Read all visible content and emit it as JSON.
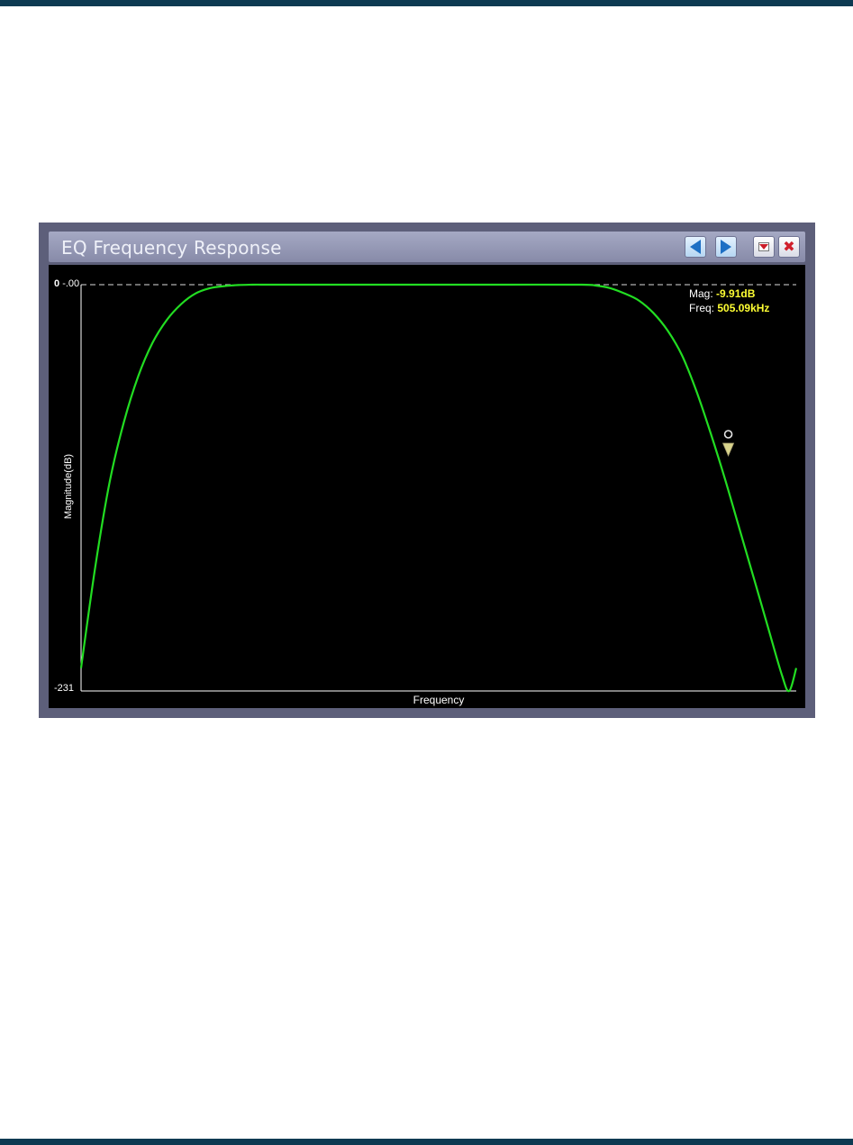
{
  "window": {
    "title": "EQ Frequency Response",
    "buttons": {
      "prev": "previous-icon",
      "next": "next-icon",
      "menu": "dropdown-icon",
      "close": "close-icon"
    }
  },
  "readout": {
    "mag_label": "Mag:",
    "mag_value": "-9.91dB",
    "freq_label": "Freq:",
    "freq_value": "505.09kHz"
  },
  "colors": {
    "curve": "#22dd22",
    "plot_bg": "#000000",
    "window_bg": "#5d5f7a",
    "readout_value": "#ffff33",
    "page_bar": "#0d3a52"
  },
  "chart_data": {
    "type": "line",
    "xlabel": "Frequency",
    "ylabel": "Magnitude(dB)",
    "ylim": [
      -231,
      0
    ],
    "ytick_labels": {
      "top": "0",
      "top_overlap": "-.00",
      "bottom": "-231"
    },
    "x_relative": [
      0.0,
      0.02,
      0.04,
      0.06,
      0.08,
      0.1,
      0.12,
      0.14,
      0.16,
      0.18,
      0.2,
      0.22,
      0.24,
      0.26,
      0.3,
      0.4,
      0.5,
      0.6,
      0.7,
      0.72,
      0.74,
      0.76,
      0.78,
      0.8,
      0.82,
      0.84,
      0.86,
      0.88,
      0.9,
      0.92,
      0.94,
      0.96,
      0.98,
      0.99,
      1.0
    ],
    "y_db": [
      -218,
      -160,
      -112,
      -78,
      -52,
      -33,
      -20,
      -11,
      -5,
      -2,
      -0.8,
      -0.2,
      0,
      0,
      0,
      0,
      0,
      0,
      0,
      -0.5,
      -2,
      -5,
      -9,
      -16,
      -26,
      -40,
      -60,
      -84,
      -110,
      -138,
      -166,
      -194,
      -222,
      -231,
      -218
    ],
    "marker": {
      "x_relative": 0.905,
      "mag_db": -9.91,
      "freq": "505.09kHz"
    }
  }
}
